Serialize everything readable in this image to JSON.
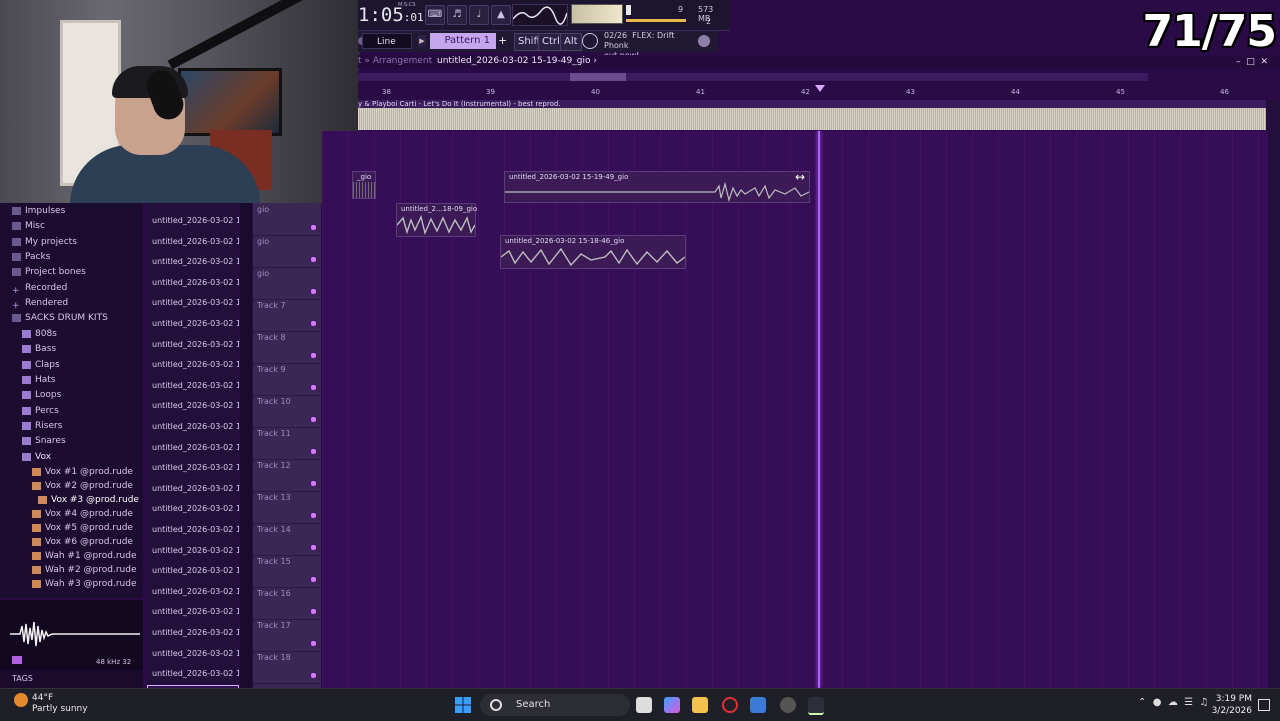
{
  "counter": "71/75",
  "toolbar": {
    "time_main": "1:05",
    "time_sub": ":01",
    "time_caption": "M:S:CS",
    "cpu_voices": "9",
    "memory": "573 MB",
    "cpu_value": "2"
  },
  "toolbar2": {
    "snap": "Line",
    "pattern": "Pattern 1",
    "add": "+",
    "shift": "Shift",
    "ctrl": "Ctrl",
    "alt": "Alt",
    "news_date": "02/26",
    "news_text": "FLEX: Drift Phonk",
    "news_text2": "out now!"
  },
  "window": {
    "section": "t » Arrangement",
    "project": "untitled_2026-03-02 15-19-49_gio",
    "arrow": "›"
  },
  "ruler": {
    "marks": [
      "38",
      "39",
      "40",
      "41",
      "42",
      "43",
      "44",
      "45",
      "46"
    ]
  },
  "song": {
    "title": "y & Playboi Carti - Let's Do It (Instrumental) - best reprod."
  },
  "browser": {
    "items": [
      {
        "label": "Impulses",
        "kind": "folder"
      },
      {
        "label": "Misc",
        "kind": "folder"
      },
      {
        "label": "My projects",
        "kind": "folder"
      },
      {
        "label": "Packs",
        "kind": "folder"
      },
      {
        "label": "Project bones",
        "kind": "folder"
      },
      {
        "label": "Recorded",
        "kind": "plus"
      },
      {
        "label": "Rendered",
        "kind": "plus"
      },
      {
        "label": "SACKS DRUM KITS",
        "kind": "folder"
      },
      {
        "label": "808s",
        "kind": "sub"
      },
      {
        "label": "Bass",
        "kind": "sub"
      },
      {
        "label": "Claps",
        "kind": "sub"
      },
      {
        "label": "Hats",
        "kind": "sub"
      },
      {
        "label": "Loops",
        "kind": "sub"
      },
      {
        "label": "Percs",
        "kind": "sub"
      },
      {
        "label": "Risers",
        "kind": "sub"
      },
      {
        "label": "Snares",
        "kind": "sub"
      },
      {
        "label": "Vox",
        "kind": "subopen"
      },
      {
        "label": "Vox #1 @prod.rude",
        "kind": "file"
      },
      {
        "label": "Vox #2 @prod.rude",
        "kind": "file"
      },
      {
        "label": "Vox #3 @prod.rude",
        "kind": "filesel"
      },
      {
        "label": "Vox #4 @prod.rude",
        "kind": "file"
      },
      {
        "label": "Vox #5 @prod.rude",
        "kind": "file"
      },
      {
        "label": "Vox #6 @prod.rude",
        "kind": "file"
      },
      {
        "label": "Wah #1 @prod.rude",
        "kind": "file"
      },
      {
        "label": "Wah #2 @prod.rude",
        "kind": "file"
      },
      {
        "label": "Wah #3 @prod.rude",
        "kind": "file"
      }
    ],
    "preview_info": "48 kHz 32",
    "tags": "TAGS"
  },
  "playlist": {
    "item_label": "untitled_2026-03-02 15-...",
    "count": 24
  },
  "tracks": [
    {
      "name": "gio"
    },
    {
      "name": "gio"
    },
    {
      "name": "gio"
    },
    {
      "name": "Track 7"
    },
    {
      "name": "Track 8"
    },
    {
      "name": "Track 9"
    },
    {
      "name": "Track 10"
    },
    {
      "name": "Track 11"
    },
    {
      "name": "Track 12"
    },
    {
      "name": "Track 13"
    },
    {
      "name": "Track 14"
    },
    {
      "name": "Track 15"
    },
    {
      "name": "Track 16"
    },
    {
      "name": "Track 17"
    },
    {
      "name": "Track 18"
    }
  ],
  "clips": [
    {
      "label": "_gio"
    },
    {
      "label": "untitled_2026-03-02 15-19-49_gio"
    },
    {
      "label": "untitled_2...18-09_gio"
    },
    {
      "label": "untitled_2026-03-02 15-18-46_gio"
    }
  ],
  "taskbar": {
    "temp": "44°F",
    "weather": "Partly sunny",
    "search": "Search",
    "time": "3:19 PM",
    "date": "3/2/2026"
  }
}
